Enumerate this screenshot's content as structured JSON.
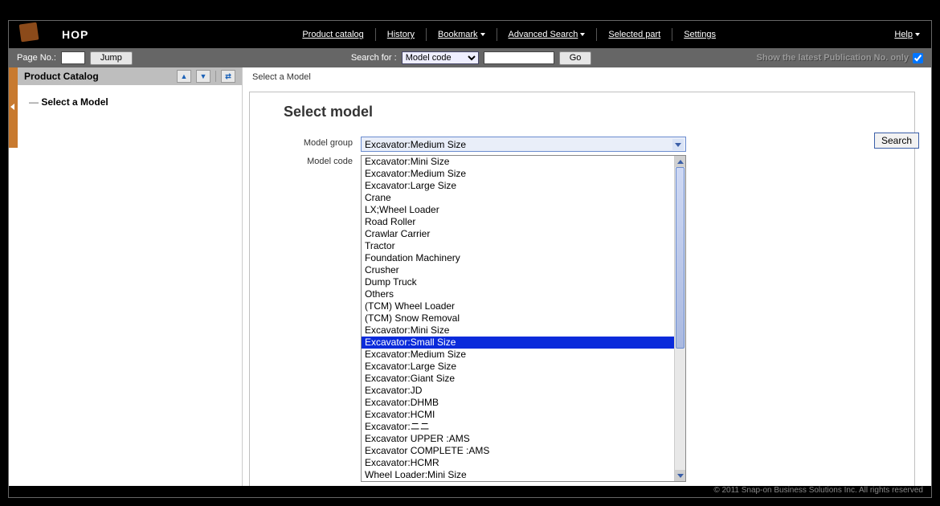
{
  "brand": "HOP",
  "topnav": {
    "product_catalog": "Product catalog",
    "history": "History",
    "bookmark": "Bookmark",
    "advanced_search": "Advanced Search",
    "selected_part": "Selected part",
    "settings": "Settings",
    "help": "Help"
  },
  "searchbar": {
    "page_no_label": "Page No.:",
    "page_no_value": "",
    "jump": "Jump",
    "search_for_label": "Search for :",
    "search_type_selected": "Model code",
    "search_value": "",
    "go": "Go",
    "latest_label": "Show the latest Publication No. only",
    "latest_checked": true
  },
  "sidebar": {
    "title": "Product Catalog",
    "tree_item": "Select a Model"
  },
  "main": {
    "breadcrumb": "Select a Model",
    "title": "Select model",
    "model_group_label": "Model group",
    "model_group_selected": "Excavator:Medium Size",
    "model_code_label": "Model code",
    "search_button": "Search",
    "dropdown_options": [
      "Excavator:Mini Size",
      "Excavator:Medium Size",
      "Excavator:Large Size",
      "Crane",
      "LX;Wheel Loader",
      "Road Roller",
      "Crawlar Carrier",
      "Tractor",
      "Foundation Machinery",
      "Crusher",
      "Dump Truck",
      "Others",
      "(TCM) Wheel Loader",
      "(TCM) Snow Removal",
      "Excavator:Mini Size",
      "Excavator:Small Size",
      "Excavator:Medium Size",
      "Excavator:Large Size",
      "Excavator:Giant Size",
      "Excavator:JD",
      "Excavator:DHMB",
      "Excavator:HCMI",
      "Excavator:ニニ",
      "Excavator UPPER :AMS",
      "Excavator COMPLETE :AMS",
      "Excavator:HCMR",
      "Wheel Loader:Mini Size"
    ],
    "dropdown_highlight_index": 15
  },
  "footer": "© 2011 Snap-on Business Solutions Inc. All rights reserved"
}
